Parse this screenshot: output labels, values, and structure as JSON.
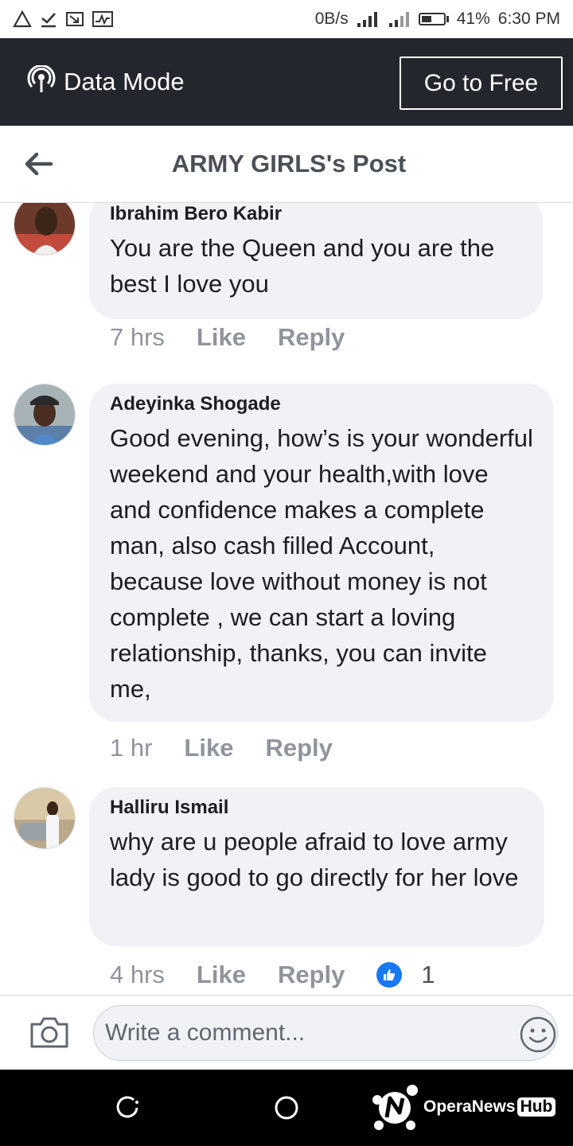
{
  "status_bar": {
    "net_speed": "0B/s",
    "battery": "41%",
    "time": "6:30 PM",
    "left_icons": [
      "warning-icon",
      "download-done-icon",
      "screen-cast-icon",
      "activity-monitor-icon"
    ],
    "right_icons": [
      "signal-icon",
      "signal-4g-icon",
      "battery-icon"
    ]
  },
  "data_mode": {
    "label": "Data Mode",
    "go_free_label": "Go to Free"
  },
  "header": {
    "title": "ARMY GIRLS's Post"
  },
  "comments": [
    {
      "author": "Ibrahim Bero Kabir",
      "text": "You are the Queen and you are the best I love you",
      "time": "7 hrs",
      "like_label": "Like",
      "reply_label": "Reply"
    },
    {
      "author": "Adeyinka Shogade",
      "text": "Good evening, how’s is your wonderful weekend and your health,with love and confidence makes a complete man, also cash filled Account, because love without money is not complete , we can start a loving relationship, thanks, you can invite me,",
      "time": "1 hr",
      "like_label": "Like",
      "reply_label": "Reply"
    },
    {
      "author": "Halliru Ismail",
      "text": "why are u people afraid to love army lady is good to go directly for her love",
      "time": "4 hrs",
      "like_label": "Like",
      "reply_label": "Reply",
      "reaction_count": "1"
    }
  ],
  "composer": {
    "placeholder": "Write a comment..."
  },
  "navbar": {
    "brand_opera": "OperaNews",
    "brand_hub": "Hub"
  },
  "colors": {
    "data_bar_bg": "#23262d",
    "bubble_bg": "#f0f2f5",
    "action_gray": "#90949c",
    "like_blue": "#1877f2"
  }
}
